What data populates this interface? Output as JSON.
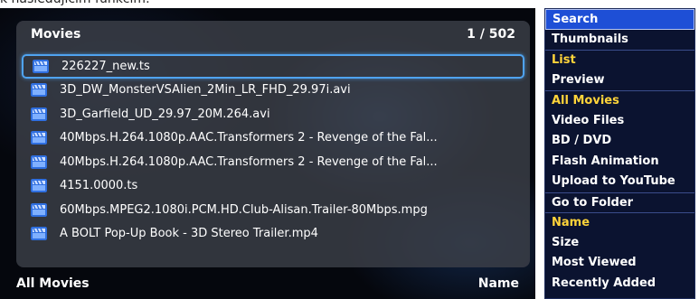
{
  "page_caption": "k nasledujícím funkcím:",
  "browser": {
    "title": "Movies",
    "counter": "1 / 502",
    "footer_left": "All Movies",
    "footer_right": "Name",
    "files": [
      {
        "name": "226227_new.ts",
        "selected": true
      },
      {
        "name": "3D_DW_MonsterVSAlien_2Min_LR_FHD_29.97i.avi",
        "selected": false
      },
      {
        "name": "3D_Garfield_UD_29.97_20M.264.avi",
        "selected": false
      },
      {
        "name": "40Mbps.H.264.1080p.AAC.Transformers 2 - Revenge of the Fal...",
        "selected": false
      },
      {
        "name": "40Mbps.H.264.1080p.AAC.Transformers 2 - Revenge of the Fal...",
        "selected": false
      },
      {
        "name": "4151.0000.ts",
        "selected": false
      },
      {
        "name": "60Mbps.MPEG2.1080i.PCM.HD.Club-Alisan.Trailer-80Mbps.mpg",
        "selected": false
      },
      {
        "name": "A BOLT Pop-Up Book - 3D Stereo Trailer.mp4",
        "selected": false
      }
    ],
    "file_icon": "movie-clapper-icon",
    "colors": {
      "selection_border": "#4fa3f0",
      "icon": "#2f6fe0"
    }
  },
  "menu": {
    "items": [
      {
        "label": "Search",
        "state": "focused"
      },
      {
        "label": "Thumbnails",
        "state": "normal"
      },
      {
        "label": "List",
        "state": "active"
      },
      {
        "label": "Preview",
        "state": "normal"
      },
      {
        "label": "All Movies",
        "state": "active"
      },
      {
        "label": "Video Files",
        "state": "normal"
      },
      {
        "label": "BD / DVD",
        "state": "normal"
      },
      {
        "label": "Flash Animation",
        "state": "normal"
      },
      {
        "label": "Upload to YouTube",
        "state": "normal"
      },
      {
        "label": "Go to Folder",
        "state": "normal"
      },
      {
        "label": "Name",
        "state": "active"
      },
      {
        "label": "Size",
        "state": "normal"
      },
      {
        "label": "Most Viewed",
        "state": "normal"
      },
      {
        "label": "Recently Added",
        "state": "normal"
      }
    ],
    "colors": {
      "background": "#0b1330",
      "active_text": "#ffd43a",
      "focus_bg": "#1e4fd6"
    }
  }
}
